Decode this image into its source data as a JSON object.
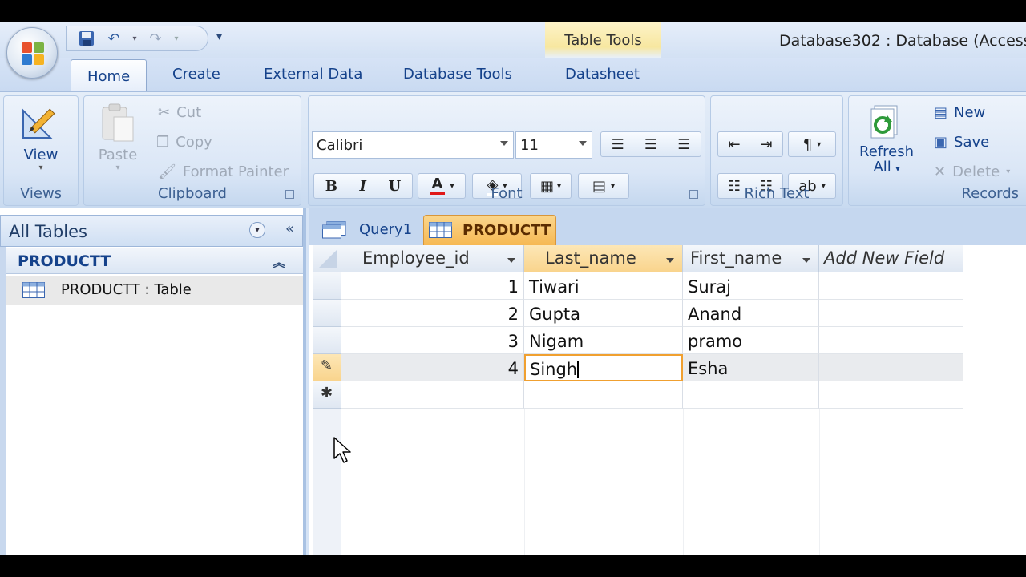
{
  "window": {
    "title": "Database302 : Database (Access",
    "contextual_tab_group": "Table Tools"
  },
  "ribbon": {
    "tabs": [
      "Home",
      "Create",
      "External Data",
      "Database Tools",
      "Datasheet"
    ],
    "active_tab": "Home",
    "groups": {
      "views": {
        "label": "Views",
        "view_label": "View"
      },
      "clipboard": {
        "label": "Clipboard",
        "paste": "Paste",
        "cut": "Cut",
        "copy": "Copy",
        "format_painter": "Format Painter"
      },
      "font": {
        "label": "Font",
        "font_name": "Calibri",
        "font_size": "11",
        "bold": "B",
        "italic": "I",
        "underline": "U",
        "font_color_glyph": "A",
        "font_color": "#e01818"
      },
      "rich_text": {
        "label": "Rich Text"
      },
      "records": {
        "label": "Records",
        "refresh": "Refresh",
        "refresh_all": "All",
        "new": "New",
        "save": "Save",
        "delete": "Delete"
      }
    }
  },
  "nav": {
    "header": "All Tables",
    "group": "PRODUCTT",
    "item": "PRODUCTT : Table"
  },
  "doc_tabs": [
    {
      "label": "Query1",
      "active": false
    },
    {
      "label": "PRODUCTT",
      "active": true
    }
  ],
  "datasheet": {
    "columns": [
      "Employee_id",
      "Last_name",
      "First_name",
      "Add New Field"
    ],
    "rows": [
      {
        "id": "1",
        "last": "Tiwari",
        "first": "Suraj"
      },
      {
        "id": "2",
        "last": "Gupta",
        "first": "Anand"
      },
      {
        "id": "3",
        "last": "Nigam",
        "first": "pramo"
      },
      {
        "id": "4",
        "last": "Singh",
        "first": "Esha"
      }
    ],
    "new_row_marker": "✱",
    "edit_row_marker": "✎"
  },
  "colors": {
    "accent": "#15428b",
    "active_doc_tab": "#f6b853",
    "selected_cell_border": "#f0a030"
  }
}
